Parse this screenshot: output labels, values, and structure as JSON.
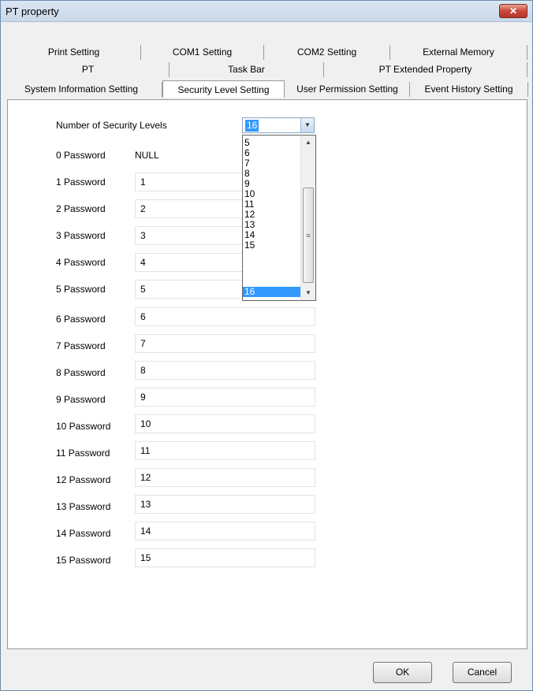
{
  "window": {
    "title": "PT property",
    "close_icon": "close-icon"
  },
  "tabs": {
    "row1": [
      "Print Setting",
      "COM1 Setting",
      "COM2 Setting",
      "External Memory"
    ],
    "row2": [
      "PT",
      "Task Bar",
      "PT Extended Property"
    ],
    "row3": [
      "System Information Setting",
      "Security Level Setting",
      "User Permission Setting",
      "Event History Setting"
    ],
    "active": "Security Level Setting"
  },
  "form": {
    "security_levels_label": "Number of Security Levels",
    "security_levels_value": "16",
    "password0_label": "0 Password",
    "password0_value": "NULL",
    "passwords": [
      {
        "label": "1 Password",
        "value": "1"
      },
      {
        "label": "2 Password",
        "value": "2"
      },
      {
        "label": "3 Password",
        "value": "3"
      },
      {
        "label": "4 Password",
        "value": "4"
      },
      {
        "label": "5 Password",
        "value": "5"
      },
      {
        "label": "6 Password",
        "value": "6"
      },
      {
        "label": "7 Password",
        "value": "7"
      },
      {
        "label": "8 Password",
        "value": "8"
      },
      {
        "label": "9 Password",
        "value": "9"
      },
      {
        "label": "10 Password",
        "value": "10"
      },
      {
        "label": "11 Password",
        "value": "11"
      },
      {
        "label": "12 Password",
        "value": "12"
      },
      {
        "label": "13 Password",
        "value": "13"
      },
      {
        "label": "14 Password",
        "value": "14"
      },
      {
        "label": "15 Password",
        "value": "15"
      }
    ]
  },
  "dropdown": {
    "options": [
      "5",
      "6",
      "7",
      "8",
      "9",
      "10",
      "11",
      "12",
      "13",
      "14",
      "15",
      "16"
    ],
    "selected": "16"
  },
  "buttons": {
    "ok": "OK",
    "cancel": "Cancel"
  },
  "colors": {
    "selection": "#3399ff",
    "close_button": "#c9483a"
  }
}
